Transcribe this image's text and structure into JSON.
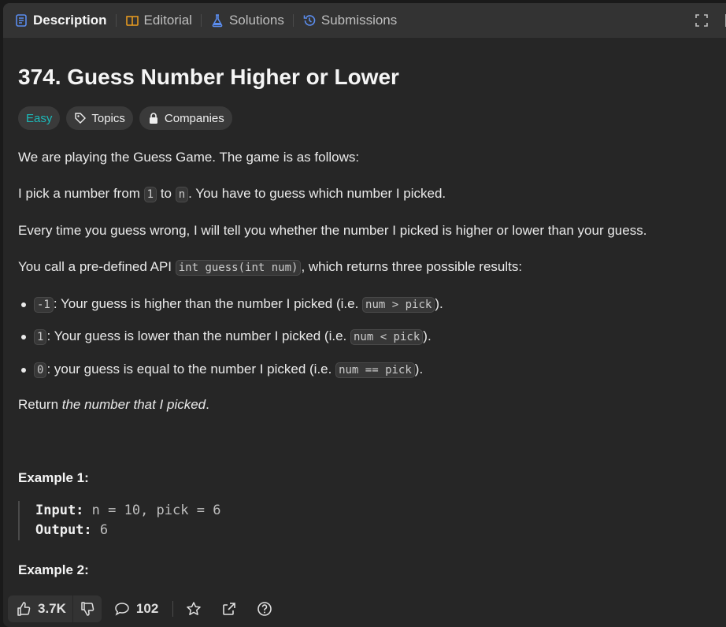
{
  "tabs": [
    {
      "label": "Description",
      "icon": "description-icon",
      "active": true
    },
    {
      "label": "Editorial",
      "icon": "book-icon"
    },
    {
      "label": "Solutions",
      "icon": "flask-icon"
    },
    {
      "label": "Submissions",
      "icon": "history-icon"
    }
  ],
  "problem": {
    "title": "374. Guess Number Higher or Lower",
    "difficulty": "Easy",
    "topics_label": "Topics",
    "companies_label": "Companies"
  },
  "description": {
    "p1": "We are playing the Guess Game. The game is as follows:",
    "p2": {
      "a": "I pick a number from ",
      "c1": "1",
      "b": " to ",
      "c2": "n",
      "c": ". You have to guess which number I picked."
    },
    "p3": "Every time you guess wrong, I will tell you whether the number I picked is higher or lower than your guess.",
    "p4": {
      "a": "You call a pre-defined API ",
      "code": "int guess(int num)",
      "b": ", which returns three possible results:"
    },
    "bullets": [
      {
        "code": "-1",
        "text": ": Your guess is higher than the number I picked (i.e. ",
        "code2": "num > pick",
        "end": ")."
      },
      {
        "code": "1",
        "text": ": Your guess is lower than the number I picked (i.e. ",
        "code2": "num < pick",
        "end": ")."
      },
      {
        "code": "0",
        "text": ": your guess is equal to the number I picked (i.e. ",
        "code2": "num == pick",
        "end": ")."
      }
    ],
    "return": {
      "a": "Return ",
      "em": "the number that I picked",
      "b": "."
    }
  },
  "examples": [
    {
      "title": "Example 1:",
      "input_label": "Input:",
      "input": "n = 10, pick = 6",
      "output_label": "Output:",
      "output": "6"
    },
    {
      "title": "Example 2:"
    }
  ],
  "bottom": {
    "likes": "3.7K",
    "comments": "102"
  }
}
